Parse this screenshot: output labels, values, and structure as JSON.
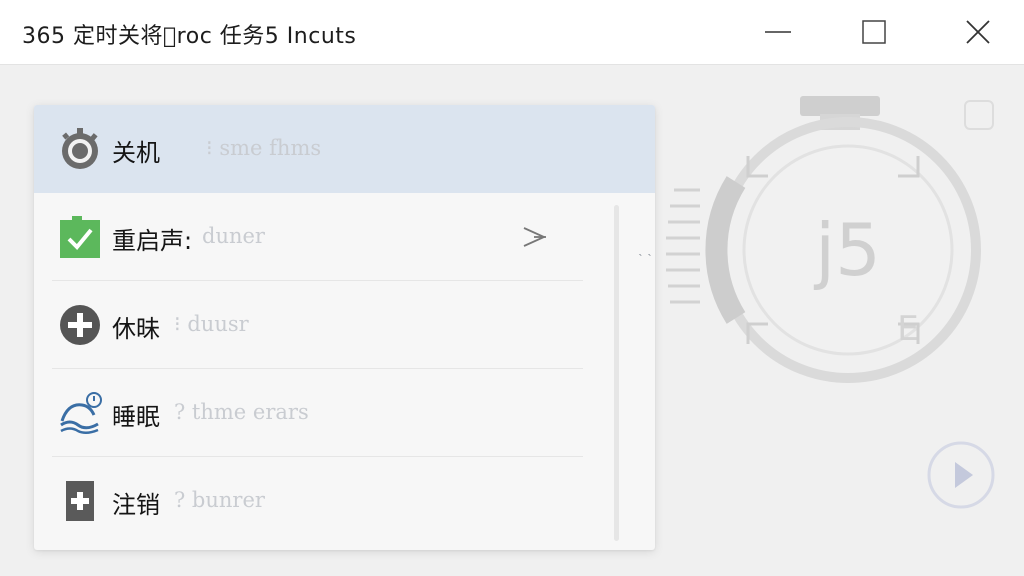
{
  "window": {
    "title": "365 定时关将𢍉roc 任务5 Incuts"
  },
  "menu": {
    "items": [
      {
        "label": "关机",
        "hint": "⁝ sme fhms",
        "selected": true,
        "icon": "power-gear-icon"
      },
      {
        "label": "重启声:",
        "hint": "duner",
        "selected": false,
        "icon": "check-icon",
        "has_arrow": true
      },
      {
        "label": "休昧",
        "hint": "⁝ duusr",
        "selected": false,
        "icon": "plus-circle-icon"
      },
      {
        "label": "睡眠",
        "hint": "? thme erars",
        "selected": false,
        "icon": "sleep-icon"
      },
      {
        "label": "注销",
        "hint": "? bunrer",
        "selected": false,
        "icon": "plus-square-icon"
      }
    ],
    "scroll_hint": "˴ ˴"
  },
  "timer": {
    "display": "j5",
    "mark": "E"
  },
  "colors": {
    "selected_bg": "#dbe4ef",
    "check_green": "#5cb85c",
    "icon_gray": "#555555",
    "sleep_blue": "#3a6ea5"
  }
}
